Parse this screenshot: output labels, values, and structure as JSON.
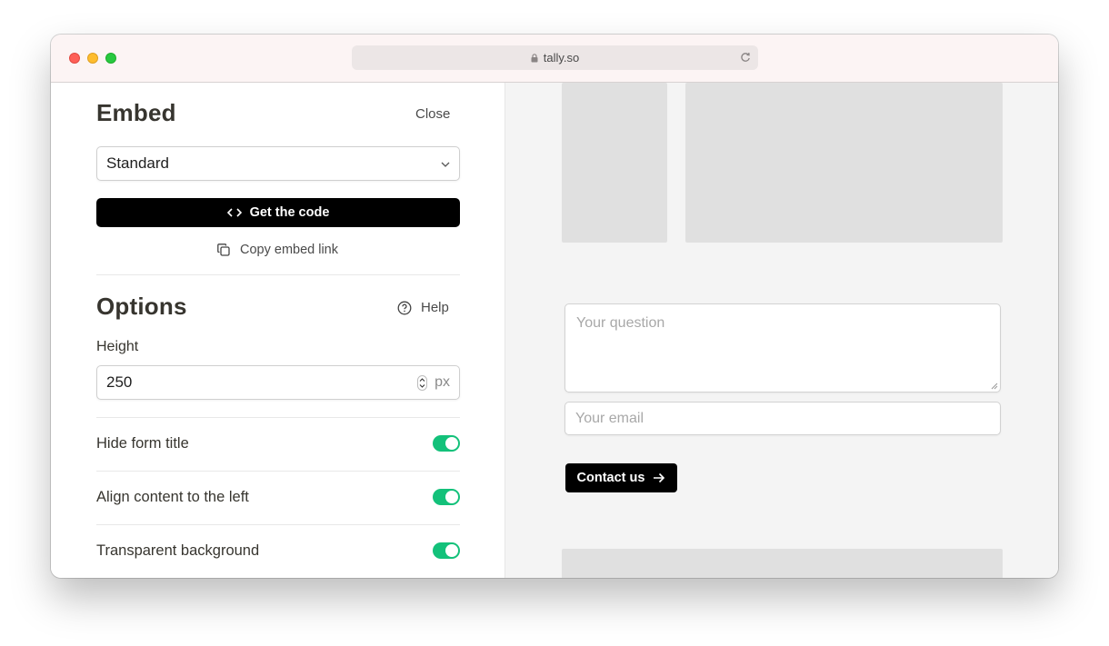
{
  "browser": {
    "url": "tally.so"
  },
  "embed": {
    "title": "Embed",
    "close_label": "Close",
    "mode_select": "Standard",
    "get_code_label": "Get the code",
    "copy_link_label": "Copy embed link"
  },
  "options": {
    "title": "Options",
    "help_label": "Help",
    "height_label": "Height",
    "height_value": "250",
    "height_unit": "px",
    "toggles": [
      {
        "label": "Hide form title",
        "on": true
      },
      {
        "label": "Align content to the left",
        "on": true
      },
      {
        "label": "Transparent background",
        "on": true
      }
    ]
  },
  "preview": {
    "question_placeholder": "Your question",
    "email_placeholder": "Your email",
    "submit_label": "Contact us"
  },
  "colors": {
    "toggle_on": "#13c17a",
    "primary": "#000000"
  }
}
